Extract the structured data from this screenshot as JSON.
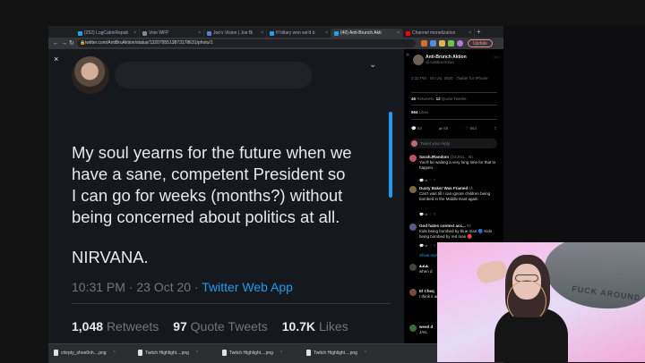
{
  "browser": {
    "tabs": [
      {
        "label": "(252) LogCabinRepub",
        "color": "#1da1f2"
      },
      {
        "label": "Vote WFP",
        "color": "#888888"
      },
      {
        "label": "Joe's Vision | Joe Bi",
        "color": "#5b7bd6"
      },
      {
        "label": "If hillary won we'd b",
        "color": "#1da1f2"
      },
      {
        "label": "(40) Anti-Brunch Akti",
        "color": "#1da1f2"
      },
      {
        "label": "Channel monetization",
        "color": "#ff0000"
      }
    ],
    "new_tab": "+",
    "url": "twitter.com/AntiBruAktion/status/1320795513873178631/photo/1",
    "update_label": "Update"
  },
  "viewer": {
    "close": "×",
    "tweet_lines": [
      "My soul yearns for the future when we",
      "have a sane, competent President so",
      "I can go for weeks (months?) without",
      "being concerned about politics at all."
    ],
    "tweet_end": "NIRVANA.",
    "timestamp": "10:31 PM · 23 Oct 20 · ",
    "source": "Twitter Web App",
    "retweets_count": "1,048",
    "retweets_label": "Retweets",
    "quotes_count": "97",
    "quotes_label": "Quote Tweets",
    "likes_count": "10.7K",
    "likes_label": "Likes",
    "action_replies": "54",
    "action_retweets": "68",
    "action_likes": "854"
  },
  "sidebar": {
    "name": "Anti-Brunch Aktion",
    "handle": "@AntiBruAktion",
    "time": "2:32 PM · Oct 26, 2020 · Twitter for iPhone",
    "retweets": "46",
    "retweets_label": "Retweets",
    "quotes": "12",
    "quotes_label": "Quote Tweets",
    "likes": "864",
    "likes_label": "Likes",
    "icon_counts": [
      "54",
      "68",
      "864"
    ],
    "reply_placeholder": "Tweet your reply",
    "replies": [
      {
        "name": "SarahJRandom",
        "handle": "@SJRa...",
        "age": "6h",
        "text": "You'll be waiting a very long time for that to happen.",
        "color": "#c0506a"
      },
      {
        "name": "Dusty Baker Was Framed",
        "handle": "",
        "age": "6h",
        "text": "Can't wait till I can ignore children being bombed in the Middle East again",
        "color": "#7a6a3a"
      },
      {
        "name": "God hates context acc...",
        "handle": "",
        "age": "6h",
        "text": "Kids being bombed by blue man 🔵 Kids being bombed by red man 🔴",
        "color": "#5a5a8a"
      },
      {
        "name": "ፈፈፈ",
        "handle": "",
        "age": "",
        "text": "when d",
        "color": "#444"
      },
      {
        "name": "El Cheq",
        "handle": "",
        "age": "",
        "text": "I think it anyone,",
        "color": "#7a4a3a"
      },
      {
        "name": "weed d",
        "handle": "",
        "age": "",
        "text": "JAIL",
        "color": "#3a6a3a"
      }
    ],
    "show_more": "Show replies"
  },
  "downloads": [
    {
      "label": "chirpty_shoe0nh....png"
    },
    {
      "label": "Twitch Highlight....png"
    },
    {
      "label": "Twitch Highlight....png"
    },
    {
      "label": "Twitch Highlight....png"
    }
  ],
  "webcam": {
    "caption": "FUCK AROUND"
  }
}
